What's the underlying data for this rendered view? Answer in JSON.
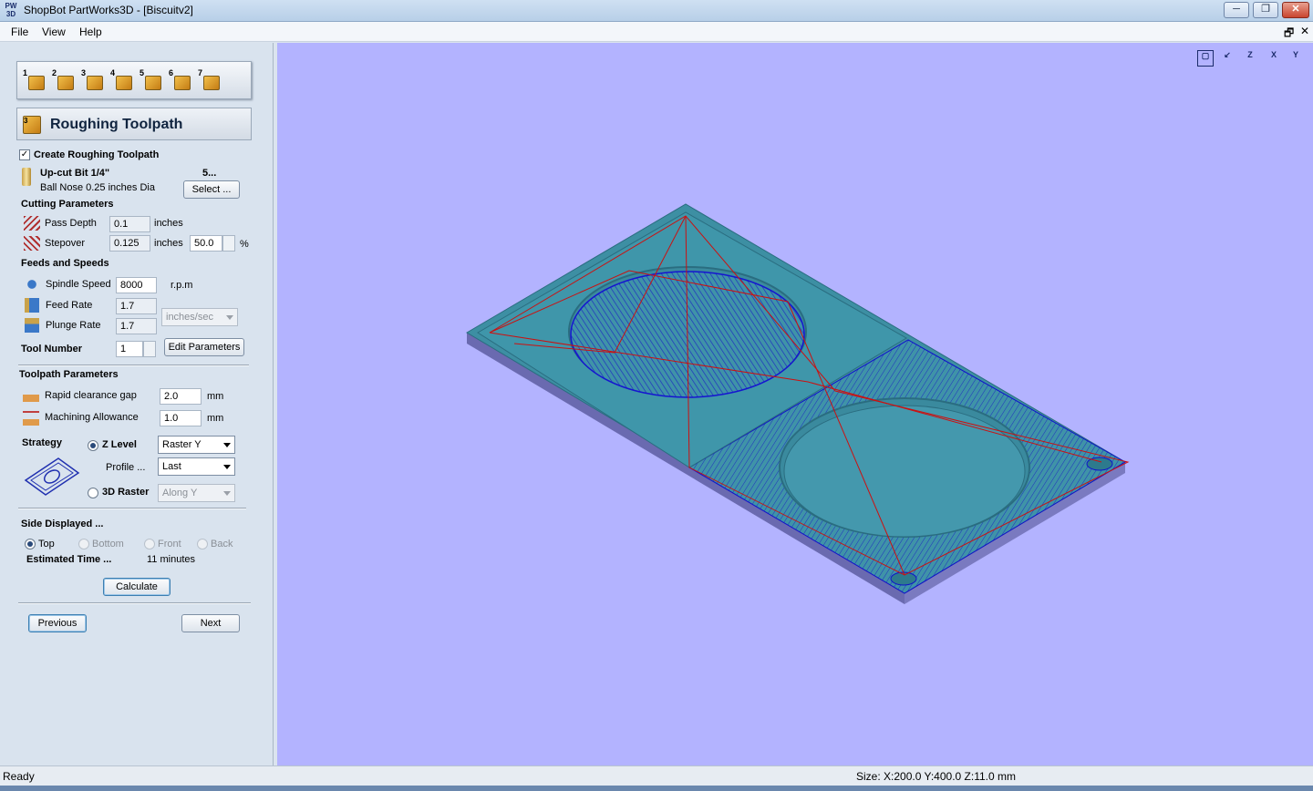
{
  "window": {
    "icon_text": "PW 3D",
    "title": "ShopBot PartWorks3D - [Biscuitv2]",
    "min_label": "─",
    "max_label": "❐",
    "close_label": "✕"
  },
  "menu": {
    "file": "File",
    "view": "View",
    "help": "Help",
    "mdi_restore": "🗗",
    "mdi_close": "✕"
  },
  "steps": [
    "1",
    "2",
    "3",
    "4",
    "5",
    "6",
    "7"
  ],
  "panel_header": {
    "num": "3",
    "title": "Roughing Toolpath"
  },
  "create": {
    "checked": true,
    "check_mark": "✓",
    "label": "Create Roughing Toolpath"
  },
  "tool": {
    "name": "Up-cut Bit 1/4\"",
    "number_short": "5...",
    "description": "Ball Nose 0.25 inches Dia",
    "select_label": "Select ..."
  },
  "cutting": {
    "heading": "Cutting Parameters",
    "pass_depth_label": "Pass Depth",
    "pass_depth": "0.1",
    "pass_depth_unit": "inches",
    "stepover_label": "Stepover",
    "stepover": "0.125",
    "stepover_unit": "inches",
    "stepover_pct": "50.0",
    "pct_sign": "%"
  },
  "feeds": {
    "heading": "Feeds and Speeds",
    "spindle_label": "Spindle Speed",
    "spindle": "8000",
    "spindle_unit": "r.p.m",
    "feed_label": "Feed Rate",
    "feed": "1.7",
    "plunge_label": "Plunge Rate",
    "plunge": "1.7",
    "rate_unit": "inches/sec",
    "toolnum_label": "Tool Number",
    "toolnum": "1",
    "edit_label": "Edit Parameters"
  },
  "toolpath": {
    "heading": "Toolpath Parameters",
    "rapid_label": "Rapid clearance gap",
    "rapid": "2.0",
    "rapid_unit": "mm",
    "allow_label": "Machining Allowance",
    "allow": "1.0",
    "allow_unit": "mm"
  },
  "strategy": {
    "heading": "Strategy",
    "zlevel_label": "Z Level",
    "zlevel_selected": true,
    "zlevel_combo": "Raster Y",
    "profile_label": "Profile ...",
    "profile_combo": "Last",
    "raster_label": "3D Raster",
    "raster_combo": "Along Y"
  },
  "side": {
    "heading": "Side Displayed ...",
    "options": [
      "Top",
      "Bottom",
      "Front",
      "Back"
    ],
    "selected": "Top"
  },
  "estimate": {
    "label": "Estimated Time ...",
    "value": "11 minutes"
  },
  "buttons": {
    "calculate": "Calculate",
    "previous": "Previous",
    "next": "Next"
  },
  "view_tools": [
    "fit-view",
    "iso-view",
    "z-view",
    "x-view",
    "y-view"
  ],
  "view_tool_labels": [
    "▢",
    "↙",
    "Z",
    "X",
    "Y"
  ],
  "status": {
    "left": "Ready",
    "right": "Size: X:200.0 Y:400.0 Z:11.0 mm"
  },
  "colors": {
    "viewport_bg": "#b3b3ff",
    "model": "#3d8fa3",
    "toolpath_blue": "#1010cc",
    "toolpath_red": "#cc1010"
  }
}
